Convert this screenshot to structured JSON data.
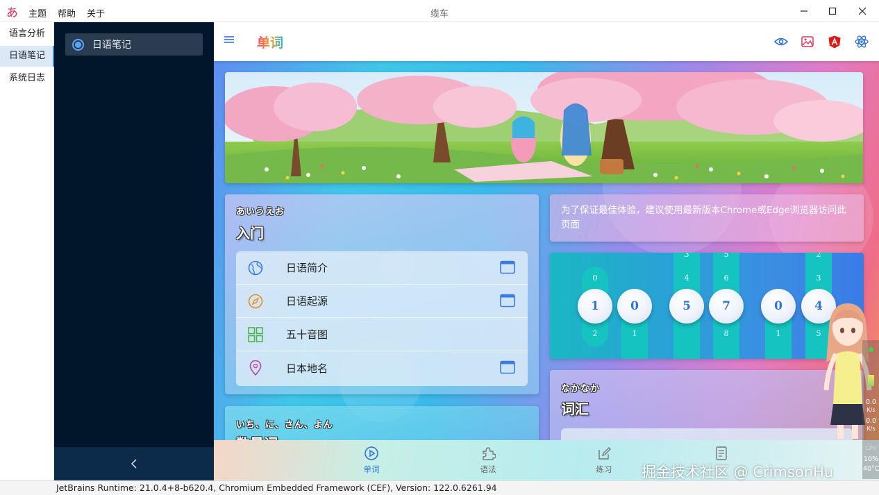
{
  "window": {
    "title": "缆车",
    "menu": [
      "主题",
      "帮助",
      "关于"
    ]
  },
  "leftnav": {
    "items": [
      {
        "label": "语言分析",
        "active": false
      },
      {
        "label": "日语笔记",
        "active": true
      },
      {
        "label": "系统日志",
        "active": false
      }
    ]
  },
  "drawer": {
    "item_label": "日语笔记"
  },
  "header": {
    "title": "单词"
  },
  "intro_card": {
    "kana": "あいうえお",
    "title": "入门",
    "items": [
      {
        "label": "日语简介",
        "icon": "globe-icon",
        "color": "#3a7ce0",
        "has_action": true
      },
      {
        "label": "日语起源",
        "icon": "compass-icon",
        "color": "#f08a1c",
        "has_action": true
      },
      {
        "label": "五十音图",
        "icon": "grid-icon",
        "color": "#4bb34b",
        "has_action": false
      },
      {
        "label": "日本地名",
        "icon": "location-pin-icon",
        "color": "#c23fa8",
        "has_action": true
      }
    ]
  },
  "numbers_card": {
    "kana": "いち、に、さん、よん",
    "title": "数量词"
  },
  "notice": {
    "text": "为了保证最佳体验，建议使用最新版本Chrome或Edge浏览器访问此页面"
  },
  "counter": {
    "digits": [
      "1",
      "0",
      "5",
      "7",
      "0",
      "4"
    ],
    "above": [
      "0",
      "",
      "4",
      "6",
      "",
      "3"
    ],
    "top_edge": [
      "",
      "",
      "3",
      "5",
      "",
      "2"
    ],
    "below": [
      "2",
      "1",
      "",
      "8",
      "1",
      "5"
    ]
  },
  "vocab_card": {
    "kana": "なかなか",
    "title": "词汇"
  },
  "bottomnav": {
    "items": [
      {
        "label": "单词",
        "icon": "play-circle-icon",
        "active": true
      },
      {
        "label": "语法",
        "icon": "puzzle-icon",
        "active": false
      },
      {
        "label": "练习",
        "icon": "edit-icon",
        "active": false
      },
      {
        "label": "",
        "icon": "document-icon",
        "active": false
      }
    ],
    "watermark": "掘金技术社区 @ CrimsonHu"
  },
  "monitor": {
    "values": [
      "0.0",
      "K/s",
      "0.0",
      "K/s",
      "CPU",
      "10%",
      "40°C"
    ]
  },
  "statusbar": {
    "text": "JetBrains Runtime: 21.0.4+8-b620.4, Chromium Embedded Framework (CEF), Version: 122.0.6261.94"
  },
  "colors": {
    "accent": "#2f74d6",
    "drawer_bg": "#01152b",
    "logo": "#e0325a"
  }
}
